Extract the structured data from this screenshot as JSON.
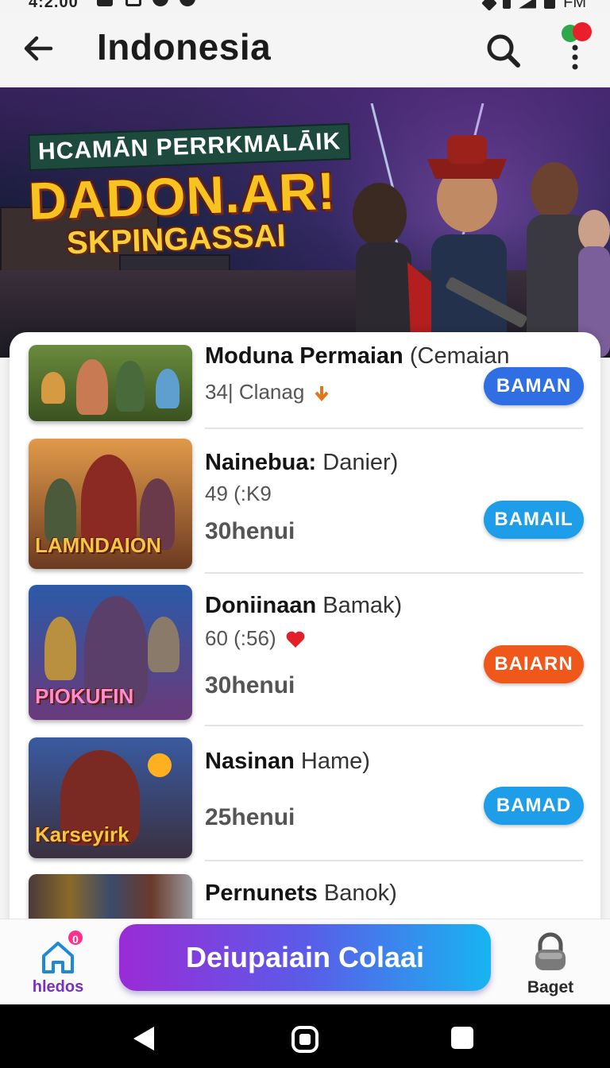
{
  "status_bar": {
    "time": "4:2.00",
    "right_text": "FM"
  },
  "app_bar": {
    "title": "Indonesia",
    "back_icon": "arrow-left-icon",
    "search_icon": "search-icon",
    "menu_icon": "overflow-menu-icon"
  },
  "banner": {
    "line1": "HCAMĀN PERRKMALĀIK",
    "line2": "DADON.AR!",
    "line3": "SKPINGASSAI"
  },
  "items": [
    {
      "title_bold": "Moduna Permaian",
      "title_light": " (Cemaian",
      "subtitle": "34| Clanag",
      "subtitle_icon": "arrow-down-icon",
      "extra": "",
      "thumb_caption": "",
      "button_label": "BAMAN",
      "button_color": "#2f6ee3"
    },
    {
      "title_bold": "Nainebua:",
      "title_light": " Danier)",
      "subtitle": "49 (:K9",
      "subtitle_icon": "",
      "extra": "30henui",
      "thumb_caption": "LAMNDAION",
      "button_label": "BAMAIL",
      "button_color": "#1e9ee9"
    },
    {
      "title_bold": "Doniinaan",
      "title_light": " Bamak)",
      "subtitle": "60 (:56)",
      "subtitle_icon": "heart-icon",
      "extra": "30henui",
      "thumb_caption": "PIOKUFIN",
      "button_label": "BAIARN",
      "button_color": "#f0571b"
    },
    {
      "title_bold": "Nasinan",
      "title_light": " Hame)",
      "subtitle": "",
      "subtitle_icon": "",
      "extra": "25henui",
      "thumb_caption": "Karseyirk",
      "button_label": "BAMAD",
      "button_color": "#1e9ee9"
    },
    {
      "title_bold": "Pernunets",
      "title_light": " Banok)",
      "subtitle": "",
      "subtitle_icon": "",
      "extra": "",
      "thumb_caption": "",
      "button_label": "",
      "button_color": ""
    }
  ],
  "bottom_nav": {
    "home_label": "hledos",
    "home_badge": "0",
    "cta_label": "Deiupaiain Colaai",
    "right_label": "Baget"
  }
}
